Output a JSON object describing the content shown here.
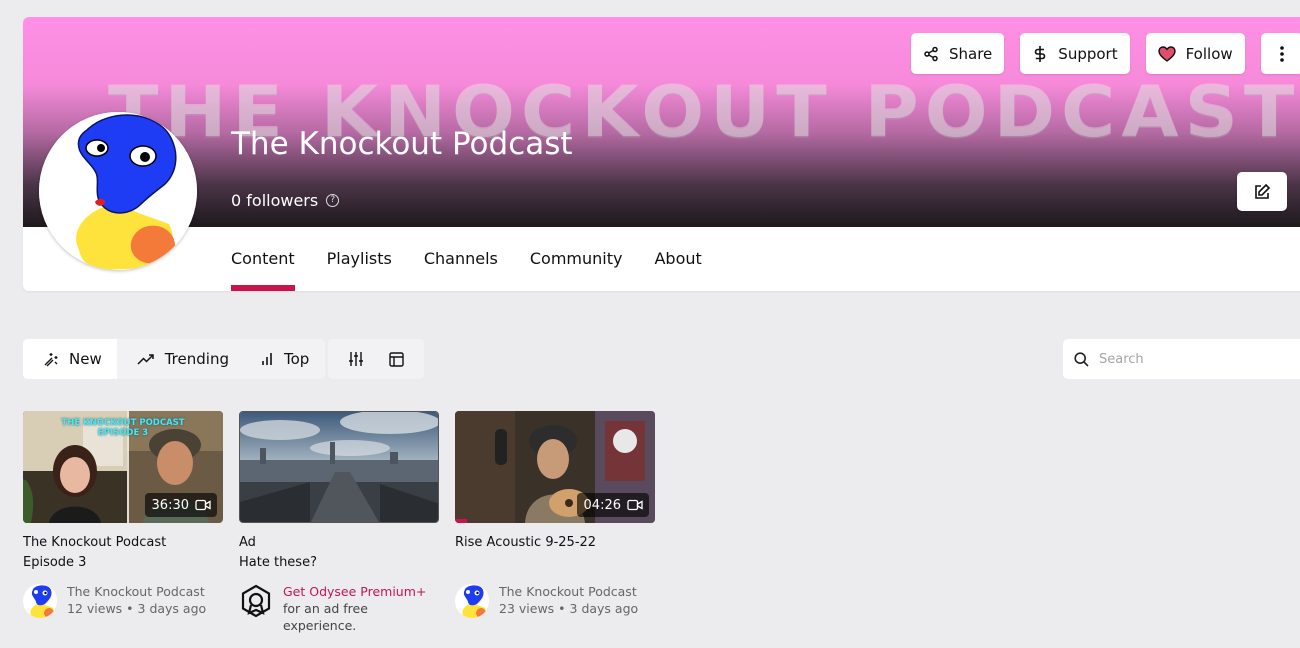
{
  "channel": {
    "banner_text": "THE KNOCKOUT PODCAST",
    "title": "The Knockout Podcast",
    "followers": "0 followers",
    "help_glyph": "?"
  },
  "header_actions": {
    "share_label": "Share",
    "support_label": "Support",
    "follow_label": "Follow"
  },
  "tabs": [
    {
      "label": "Content",
      "active": true
    },
    {
      "label": "Playlists",
      "active": false
    },
    {
      "label": "Channels",
      "active": false
    },
    {
      "label": "Community",
      "active": false
    },
    {
      "label": "About",
      "active": false
    }
  ],
  "filters": {
    "new_label": "New",
    "trending_label": "Trending",
    "top_label": "Top"
  },
  "search": {
    "placeholder": "Search"
  },
  "cards": [
    {
      "title_line1": "The Knockout Podcast",
      "title_line2": "Episode 3",
      "duration": "36:30",
      "thumb_caption_line1": "THE KNOCKOUT PODCAST",
      "thumb_caption_line2": "EPISODE 3",
      "channel": "The Knockout Podcast",
      "views": "12 views",
      "age": "3 days ago"
    },
    {
      "title_line1": "Ad",
      "title_line2": "Hate these?",
      "promo": "Get Odysee Premium+",
      "promo_sub": "for an ad free experience."
    },
    {
      "title_line1": "Rise Acoustic 9-25-22",
      "duration": "04:26",
      "watched_fraction": 0.06,
      "channel": "The Knockout Podcast",
      "views": "23 views",
      "age": "3 days ago"
    }
  ],
  "colors": {
    "accent": "#c9144c",
    "cover_pink": "#ff90e6",
    "background": "#ececef"
  },
  "icons": [
    "share-icon",
    "dollar-icon",
    "heart-icon",
    "more-vertical-icon",
    "edit-icon",
    "new-sparkle-icon",
    "trending-icon",
    "top-bars-icon",
    "filter-sliders-icon",
    "layout-icon",
    "search-icon",
    "video-camera-icon",
    "odysee-premium-icon"
  ]
}
